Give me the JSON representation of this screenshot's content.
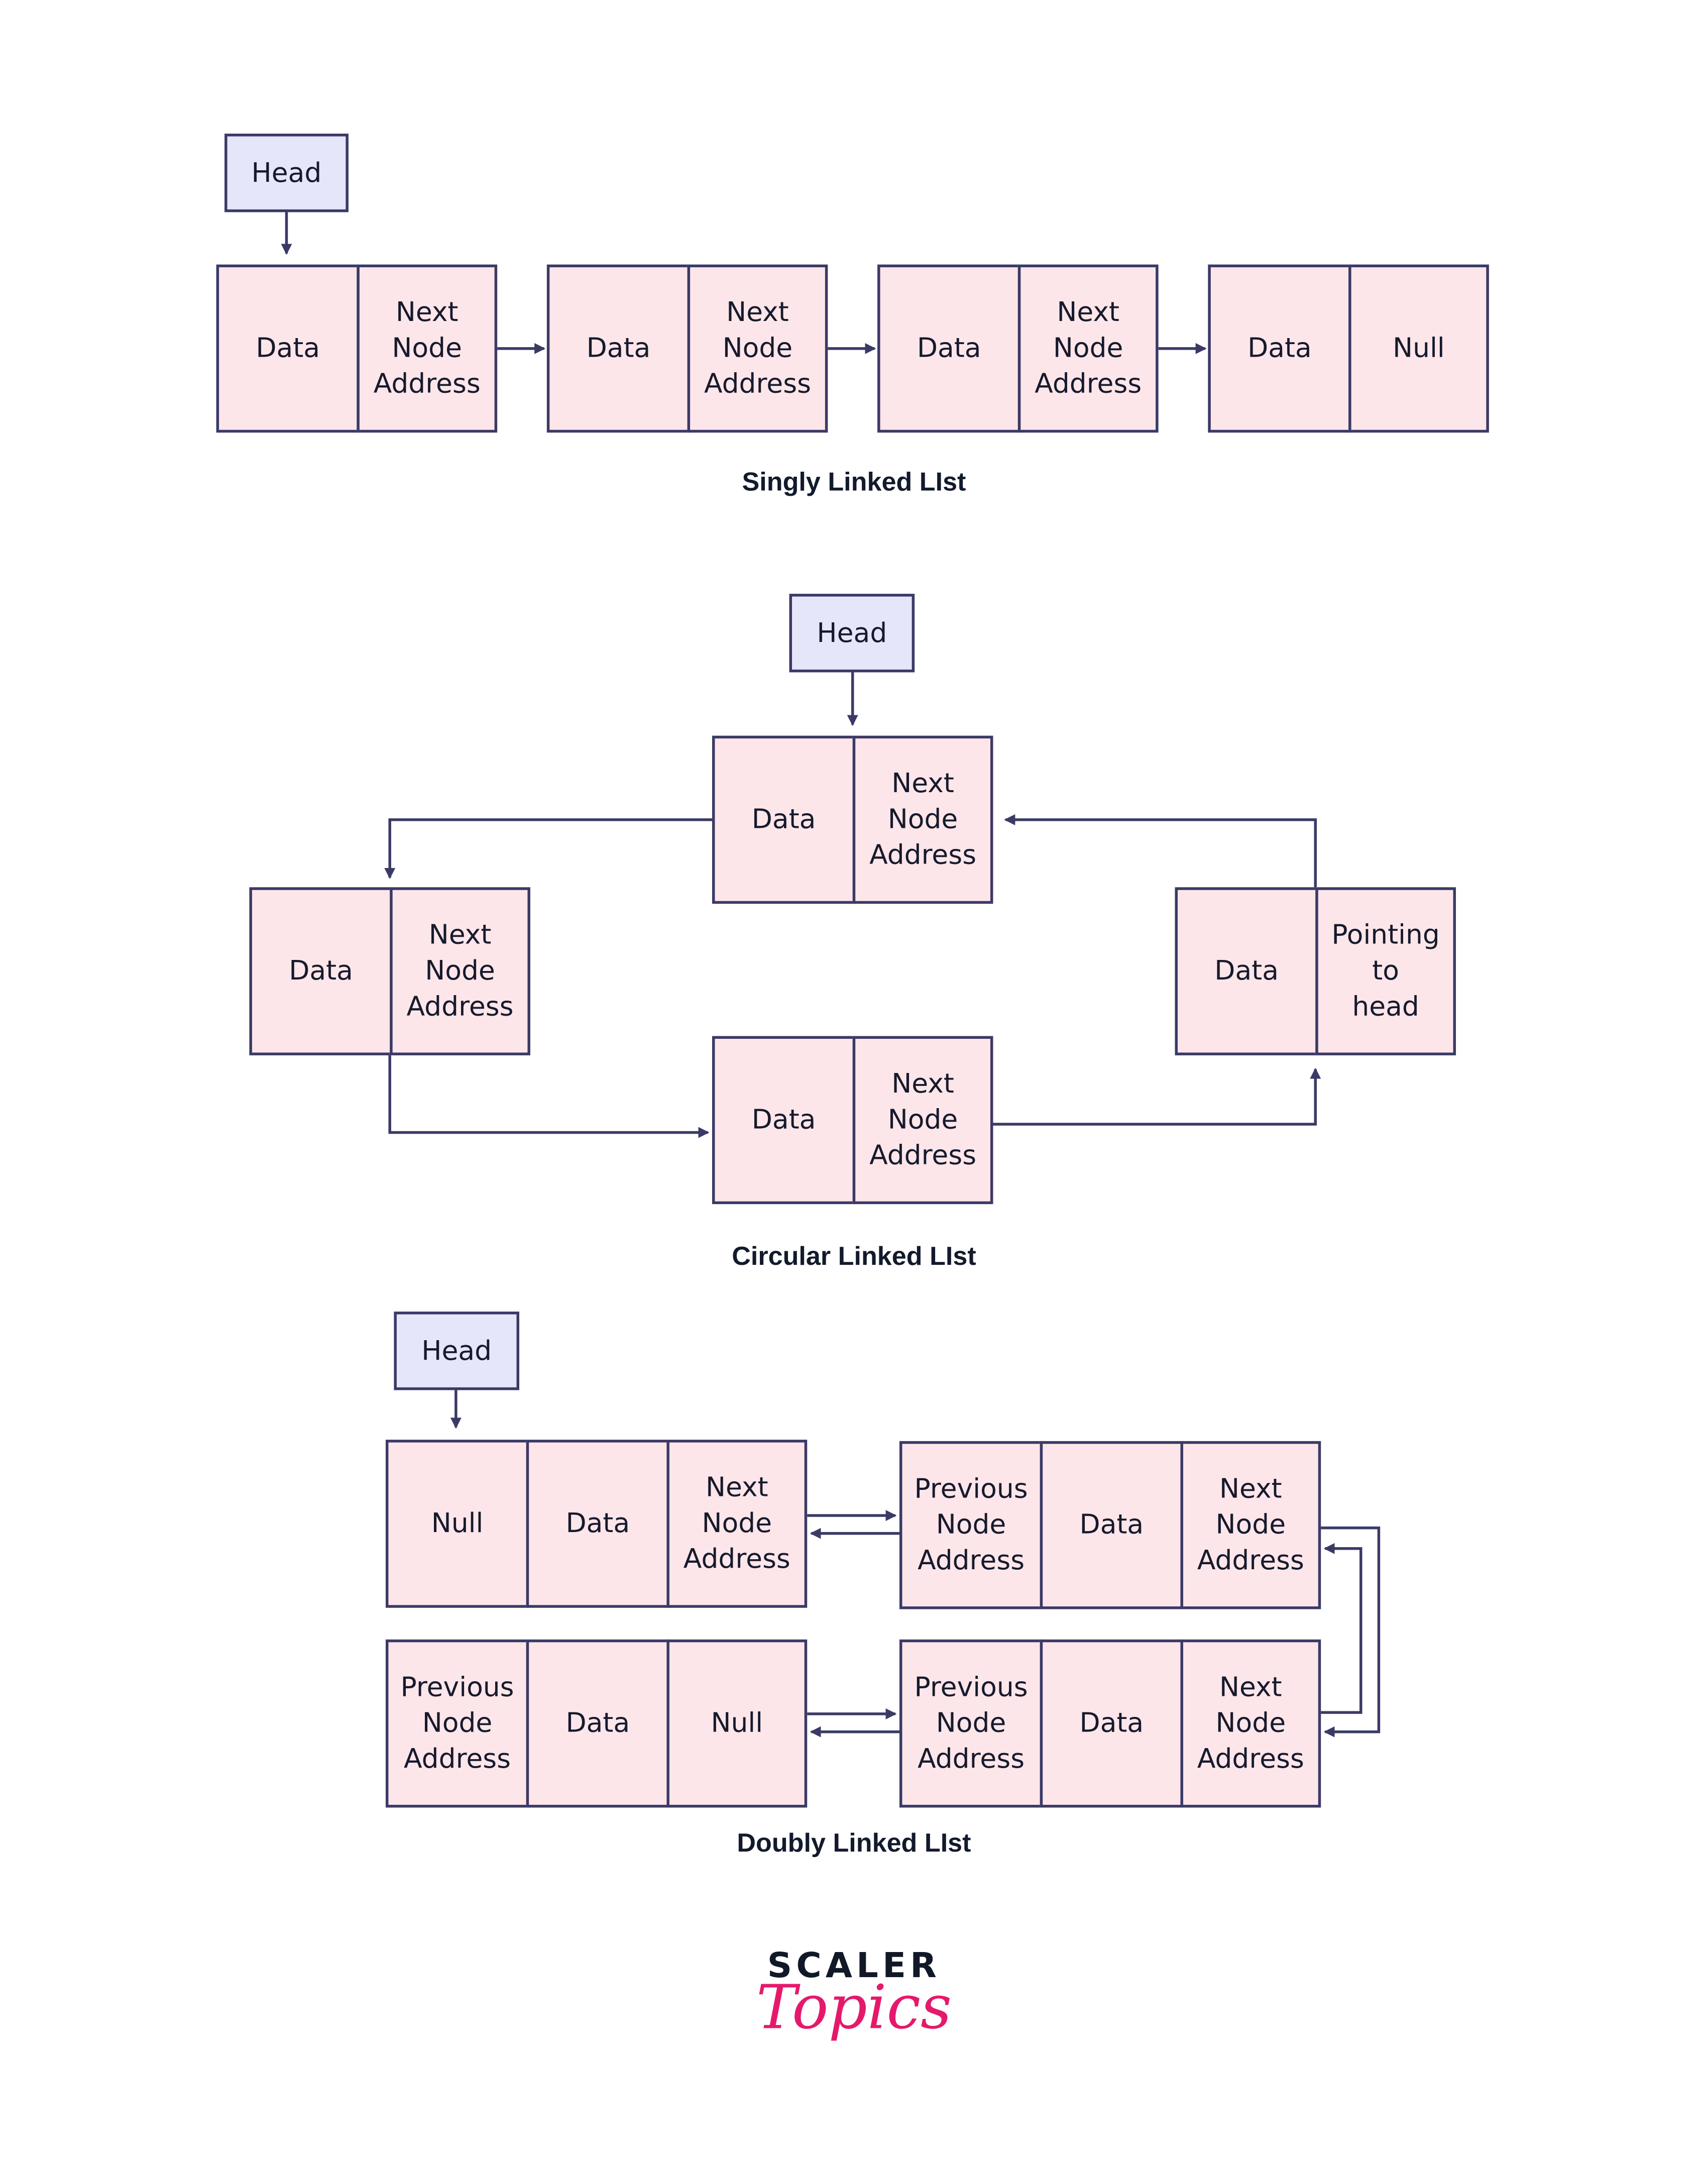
{
  "colors": {
    "node_fill": "#fde6ea",
    "head_fill": "#e6e6fb",
    "stroke": "#3b3a66",
    "text": "#161a2c",
    "logo_accent": "#e5196b"
  },
  "singly": {
    "caption": "Singly Linked LIst",
    "head": "Head",
    "nodes": [
      {
        "data": "Data",
        "next": "Next\nNode\nAddress"
      },
      {
        "data": "Data",
        "next": "Next\nNode\nAddress"
      },
      {
        "data": "Data",
        "next": "Next\nNode\nAddress"
      },
      {
        "data": "Data",
        "next": "Null"
      }
    ]
  },
  "circular": {
    "caption": "Circular Linked LIst",
    "head": "Head",
    "nodes": [
      {
        "data": "Data",
        "next": "Next\nNode\nAddress"
      },
      {
        "data": "Data",
        "next": "Next\nNode\nAddress"
      },
      {
        "data": "Data",
        "next": "Next\nNode\nAddress"
      },
      {
        "data": "Data",
        "next": "Pointing\nto\nhead"
      }
    ]
  },
  "doubly": {
    "caption": "Doubly Linked LIst",
    "head": "Head",
    "nodes": [
      {
        "prev": "Null",
        "data": "Data",
        "next": "Next\nNode\nAddress"
      },
      {
        "prev": "Previous\nNode\nAddress",
        "data": "Data",
        "next": "Next\nNode\nAddress"
      },
      {
        "prev": "Previous\nNode\nAddress",
        "data": "Data",
        "next": "Next\nNode\nAddress"
      },
      {
        "prev": "Previous\nNode\nAddress",
        "data": "Data",
        "next": "Null"
      }
    ]
  },
  "logo": {
    "top": "SCALER",
    "bottom": "Topics"
  }
}
